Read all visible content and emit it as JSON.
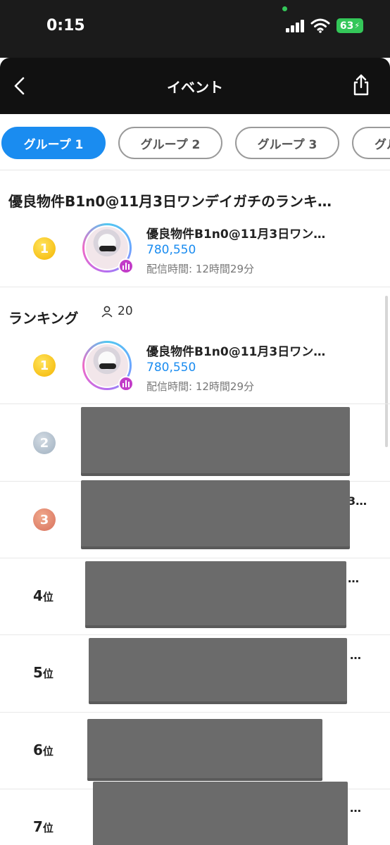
{
  "status_bar": {
    "time": "0:15",
    "battery": "63"
  },
  "nav": {
    "title": "イベント",
    "back_icon": "chevron-left-icon",
    "share_icon": "share-icon"
  },
  "tabs": [
    {
      "label": "グループ 1",
      "active": true
    },
    {
      "label": "グループ 2",
      "active": false
    },
    {
      "label": "グループ 3",
      "active": false
    },
    {
      "label": "グル",
      "active": false
    }
  ],
  "featured": {
    "title": "優良物件B1n0@11月3日ワンデイガチのランキ…",
    "entry": {
      "rank": "1",
      "name": "優良物件B1n0@11月3日ワン…",
      "score": "780,550",
      "time": "配信時間: 12時間29分"
    }
  },
  "ranking": {
    "title": "ランキング",
    "count": "20",
    "top": {
      "rank": "1",
      "name": "優良物件B1n0@11月3日ワン…",
      "score": "780,550",
      "time": "配信時間: 12時間29分"
    },
    "medal_ranks": [
      "2",
      "3"
    ],
    "ranks": [
      {
        "num": "4",
        "suffix": "位"
      },
      {
        "num": "5",
        "suffix": "位"
      },
      {
        "num": "6",
        "suffix": "位"
      },
      {
        "num": "7",
        "suffix": "位"
      }
    ],
    "peek_text": [
      "3…",
      "…",
      "…",
      "…"
    ]
  },
  "colors": {
    "accent": "#1a8cf0",
    "header": "#111111",
    "redaction": "#6b6b6b",
    "live_badge": "#c23cc8"
  }
}
